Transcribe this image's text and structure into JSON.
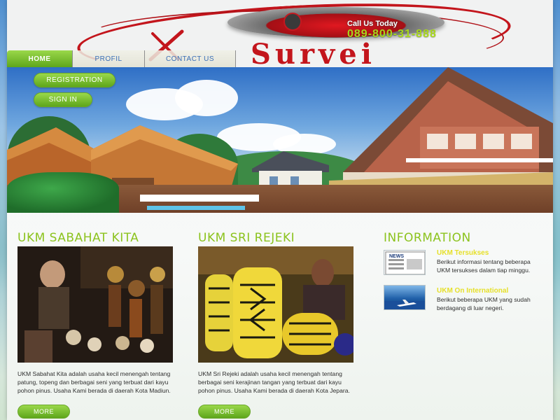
{
  "header": {
    "logo_text": "Survei",
    "call_label": "Call Us Today",
    "phone": "089-800-31-888"
  },
  "nav": {
    "items": [
      {
        "label": "HOME"
      },
      {
        "label": "PROFIL"
      },
      {
        "label": "CONTACT US"
      }
    ]
  },
  "hero": {
    "registration_label": "REGISTRATION",
    "signin_label": "SIGN IN"
  },
  "columns": [
    {
      "title": "UKM SABAHAT KITA",
      "description": "UKM Sabahat Kita adalah usaha kecil menengah tentang patung, topeng dan berbagai seni yang terbuat dari kayu pohon pinus. Usaha Kami berada di daerah Kota Madiun.",
      "more_label": "MORE"
    },
    {
      "title": "UKM SRI REJEKI",
      "description": "UKM Sri Rejeki adalah usaha kecil menengah tentang berbagai seni kerajinan tangan yang terbuat dari kayu pohon pinus. Usaha Kami berada di daerah Kota Jepara.",
      "more_label": "MORE"
    }
  ],
  "information": {
    "title": "INFORMATION",
    "items": [
      {
        "thumb_text": "NEWS",
        "title": "UKM Tersukses",
        "text": "Berikut informasi tentang beberapa UKM tersukses dalam tiap minggu."
      },
      {
        "title": "UKM On International",
        "text": "Berikut beberapa UKM yang sudah berdagang di luar negeri."
      }
    ]
  },
  "colors": {
    "accent_green": "#8cc31e",
    "logo_red": "#c3151c",
    "phone_green": "#a8d81c",
    "info_title_yellow": "#e6e02a"
  }
}
